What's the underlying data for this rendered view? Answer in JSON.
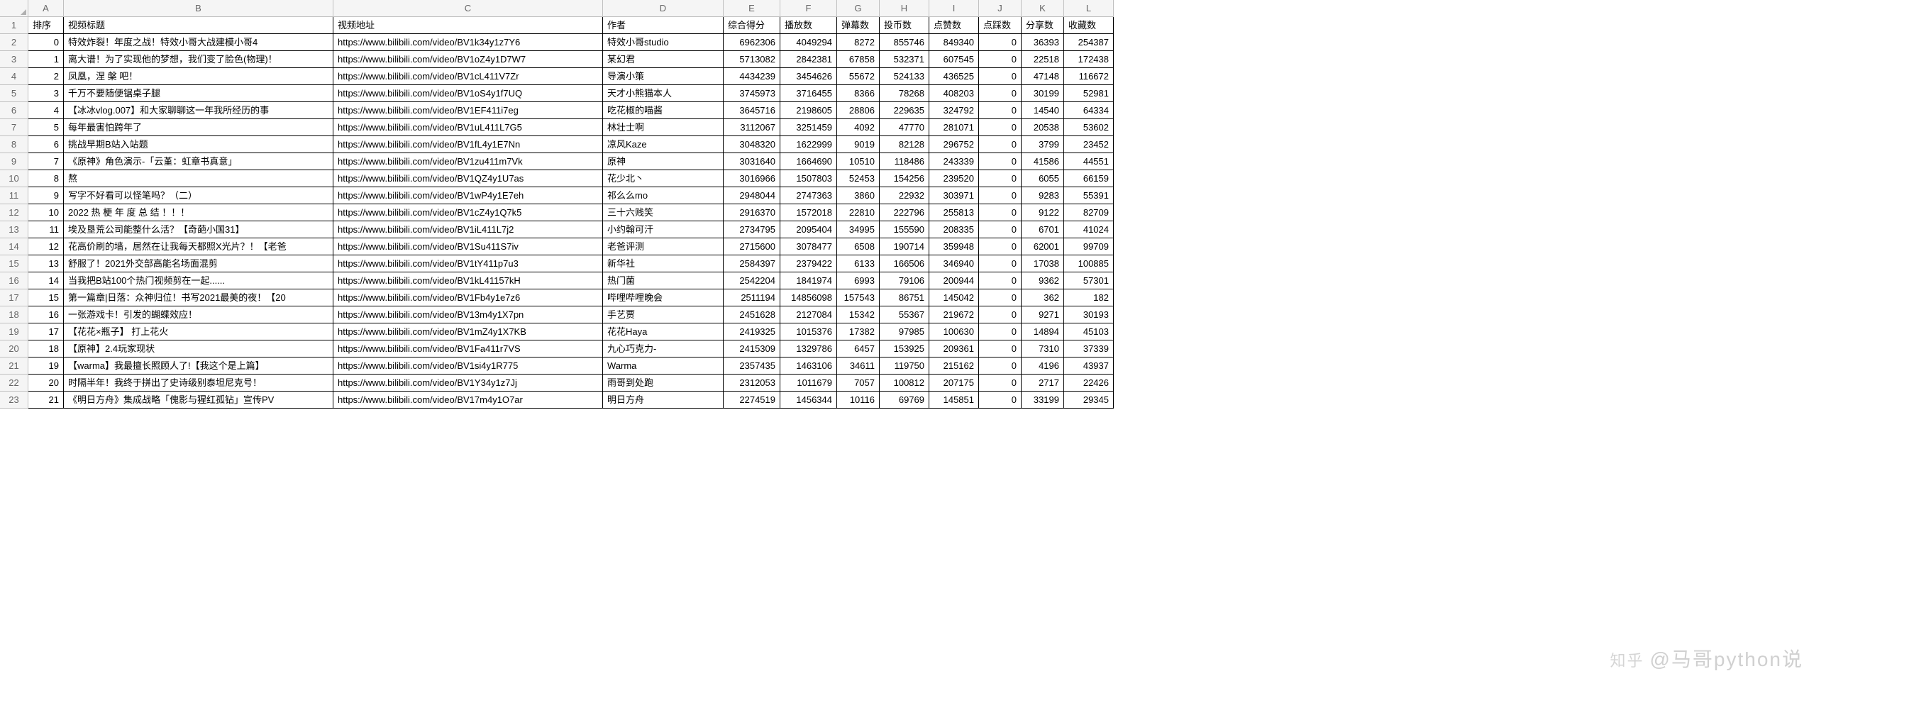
{
  "watermark_prefix": "知乎",
  "watermark_text": "@马哥python说",
  "columns": [
    "A",
    "B",
    "C",
    "D",
    "E",
    "F",
    "G",
    "H",
    "I",
    "J",
    "K",
    "L"
  ],
  "headers": [
    "排序",
    "视频标题",
    "视频地址",
    "作者",
    "综合得分",
    "播放数",
    "弹幕数",
    "投币数",
    "点赞数",
    "点踩数",
    "分享数",
    "收藏数"
  ],
  "rows": [
    {
      "n": 1,
      "data": [
        "0",
        "特效炸裂！年度之战！特效小哥大战建模小哥4",
        "https://www.bilibili.com/video/BV1k34y1z7Y6",
        "特效小哥studio",
        "6962306",
        "4049294",
        "8272",
        "855746",
        "849340",
        "0",
        "36393",
        "254387"
      ]
    },
    {
      "n": 2,
      "data": [
        "1",
        "离大谱！为了实现他的梦想，我们变了脸色(物理)！",
        "https://www.bilibili.com/video/BV1oZ4y1D7W7",
        "某幻君",
        "5713082",
        "2842381",
        "67858",
        "532371",
        "607545",
        "0",
        "22518",
        "172438"
      ]
    },
    {
      "n": 3,
      "data": [
        "2",
        "凤凰，涅 槃 吧！",
        "https://www.bilibili.com/video/BV1cL411V7Zr",
        "导演小策",
        "4434239",
        "3454626",
        "55672",
        "524133",
        "436525",
        "0",
        "47148",
        "116672"
      ]
    },
    {
      "n": 4,
      "data": [
        "3",
        "千万不要随便锯桌子腿",
        "https://www.bilibili.com/video/BV1oS4y1f7UQ",
        "天才小熊猫本人",
        "3745973",
        "3716455",
        "8366",
        "78268",
        "408203",
        "0",
        "30199",
        "52981"
      ]
    },
    {
      "n": 5,
      "data": [
        "4",
        "【冰冰vlog.007】和大家聊聊这一年我所经历的事",
        "https://www.bilibili.com/video/BV1EF411i7eg",
        "吃花椒的喵酱",
        "3645716",
        "2198605",
        "28806",
        "229635",
        "324792",
        "0",
        "14540",
        "64334"
      ]
    },
    {
      "n": 6,
      "data": [
        "5",
        "每年最害怕跨年了",
        "https://www.bilibili.com/video/BV1uL411L7G5",
        "林壮士啊",
        "3112067",
        "3251459",
        "4092",
        "47770",
        "281071",
        "0",
        "20538",
        "53602"
      ]
    },
    {
      "n": 7,
      "data": [
        "6",
        "挑战早期B站入站题",
        "https://www.bilibili.com/video/BV1fL4y1E7Nn",
        "凉风Kaze",
        "3048320",
        "1622999",
        "9019",
        "82128",
        "296752",
        "0",
        "3799",
        "23452"
      ]
    },
    {
      "n": 8,
      "data": [
        "7",
        "《原神》角色演示-「云堇：虹章书真意」",
        "https://www.bilibili.com/video/BV1zu411m7Vk",
        "原神",
        "3031640",
        "1664690",
        "10510",
        "118486",
        "243339",
        "0",
        "41586",
        "44551"
      ]
    },
    {
      "n": 9,
      "data": [
        "8",
        "熬",
        "https://www.bilibili.com/video/BV1QZ4y1U7as",
        "花少北丶",
        "3016966",
        "1507803",
        "52453",
        "154256",
        "239520",
        "0",
        "6055",
        "66159"
      ]
    },
    {
      "n": 10,
      "data": [
        "9",
        "写字不好看可以怪笔吗？（二）",
        "https://www.bilibili.com/video/BV1wP4y1E7eh",
        "祁么么mo",
        "2948044",
        "2747363",
        "3860",
        "22932",
        "303971",
        "0",
        "9283",
        "55391"
      ]
    },
    {
      "n": 11,
      "data": [
        "10",
        "2022 热 梗 年 度 总 结 ！！！",
        "https://www.bilibili.com/video/BV1cZ4y1Q7k5",
        "三十六贱笑",
        "2916370",
        "1572018",
        "22810",
        "222796",
        "255813",
        "0",
        "9122",
        "82709"
      ]
    },
    {
      "n": 12,
      "data": [
        "11",
        "埃及垦荒公司能整什么活？【奇葩小国31】",
        "https://www.bilibili.com/video/BV1iL411L7j2",
        "小约翰可汗",
        "2734795",
        "2095404",
        "34995",
        "155590",
        "208335",
        "0",
        "6701",
        "41024"
      ]
    },
    {
      "n": 13,
      "data": [
        "12",
        "花高价刷的墙，居然在让我每天都照X光片？！【老爸",
        "https://www.bilibili.com/video/BV1Su411S7iv",
        "老爸评测",
        "2715600",
        "3078477",
        "6508",
        "190714",
        "359948",
        "0",
        "62001",
        "99709"
      ]
    },
    {
      "n": 14,
      "data": [
        "13",
        "舒服了！2021外交部高能名场面混剪",
        "https://www.bilibili.com/video/BV1tY411p7u3",
        "新华社",
        "2584397",
        "2379422",
        "6133",
        "166506",
        "346940",
        "0",
        "17038",
        "100885"
      ]
    },
    {
      "n": 15,
      "data": [
        "14",
        "当我把B站100个热门视频剪在一起......",
        "https://www.bilibili.com/video/BV1kL41157kH",
        "热门菌",
        "2542204",
        "1841974",
        "6993",
        "79106",
        "200944",
        "0",
        "9362",
        "57301"
      ]
    },
    {
      "n": 16,
      "data": [
        "15",
        "第一篇章|日落：众神归位！书写2021最美的夜！【20",
        "https://www.bilibili.com/video/BV1Fb4y1e7z6",
        "哔哩哔哩晚会",
        "2511194",
        "14856098",
        "157543",
        "86751",
        "145042",
        "0",
        "362",
        "182"
      ]
    },
    {
      "n": 17,
      "data": [
        "16",
        "一张游戏卡！引发的蝴蝶效应！",
        "https://www.bilibili.com/video/BV13m4y1X7pn",
        "手艺贾",
        "2451628",
        "2127084",
        "15342",
        "55367",
        "219672",
        "0",
        "9271",
        "30193"
      ]
    },
    {
      "n": 18,
      "data": [
        "17",
        "【花花×瓶子】 打上花火",
        "https://www.bilibili.com/video/BV1mZ4y1X7KB",
        "花花Haya",
        "2419325",
        "1015376",
        "17382",
        "97985",
        "100630",
        "0",
        "14894",
        "45103"
      ]
    },
    {
      "n": 19,
      "data": [
        "18",
        "【原神】2.4玩家现状",
        "https://www.bilibili.com/video/BV1Fa411r7VS",
        "九心巧克力-",
        "2415309",
        "1329786",
        "6457",
        "153925",
        "209361",
        "0",
        "7310",
        "37339"
      ]
    },
    {
      "n": 20,
      "data": [
        "19",
        "【warma】我最擅长照顾人了!【我这个是上篇】",
        "https://www.bilibili.com/video/BV1si4y1R775",
        "Warma",
        "2357435",
        "1463106",
        "34611",
        "119750",
        "215162",
        "0",
        "4196",
        "43937"
      ]
    },
    {
      "n": 21,
      "data": [
        "20",
        "时隔半年！我终于拼出了史诗级别泰坦尼克号！",
        "https://www.bilibili.com/video/BV1Y34y1z7Jj",
        "雨哥到处跑",
        "2312053",
        "1011679",
        "7057",
        "100812",
        "207175",
        "0",
        "2717",
        "22426"
      ]
    },
    {
      "n": 22,
      "data": [
        "21",
        "《明日方舟》集成战略「傀影与猩红孤钻」宣传PV",
        "https://www.bilibili.com/video/BV17m4y1O7ar",
        "明日方舟",
        "2274519",
        "1456344",
        "10116",
        "69769",
        "145851",
        "0",
        "33199",
        "29345"
      ]
    }
  ]
}
